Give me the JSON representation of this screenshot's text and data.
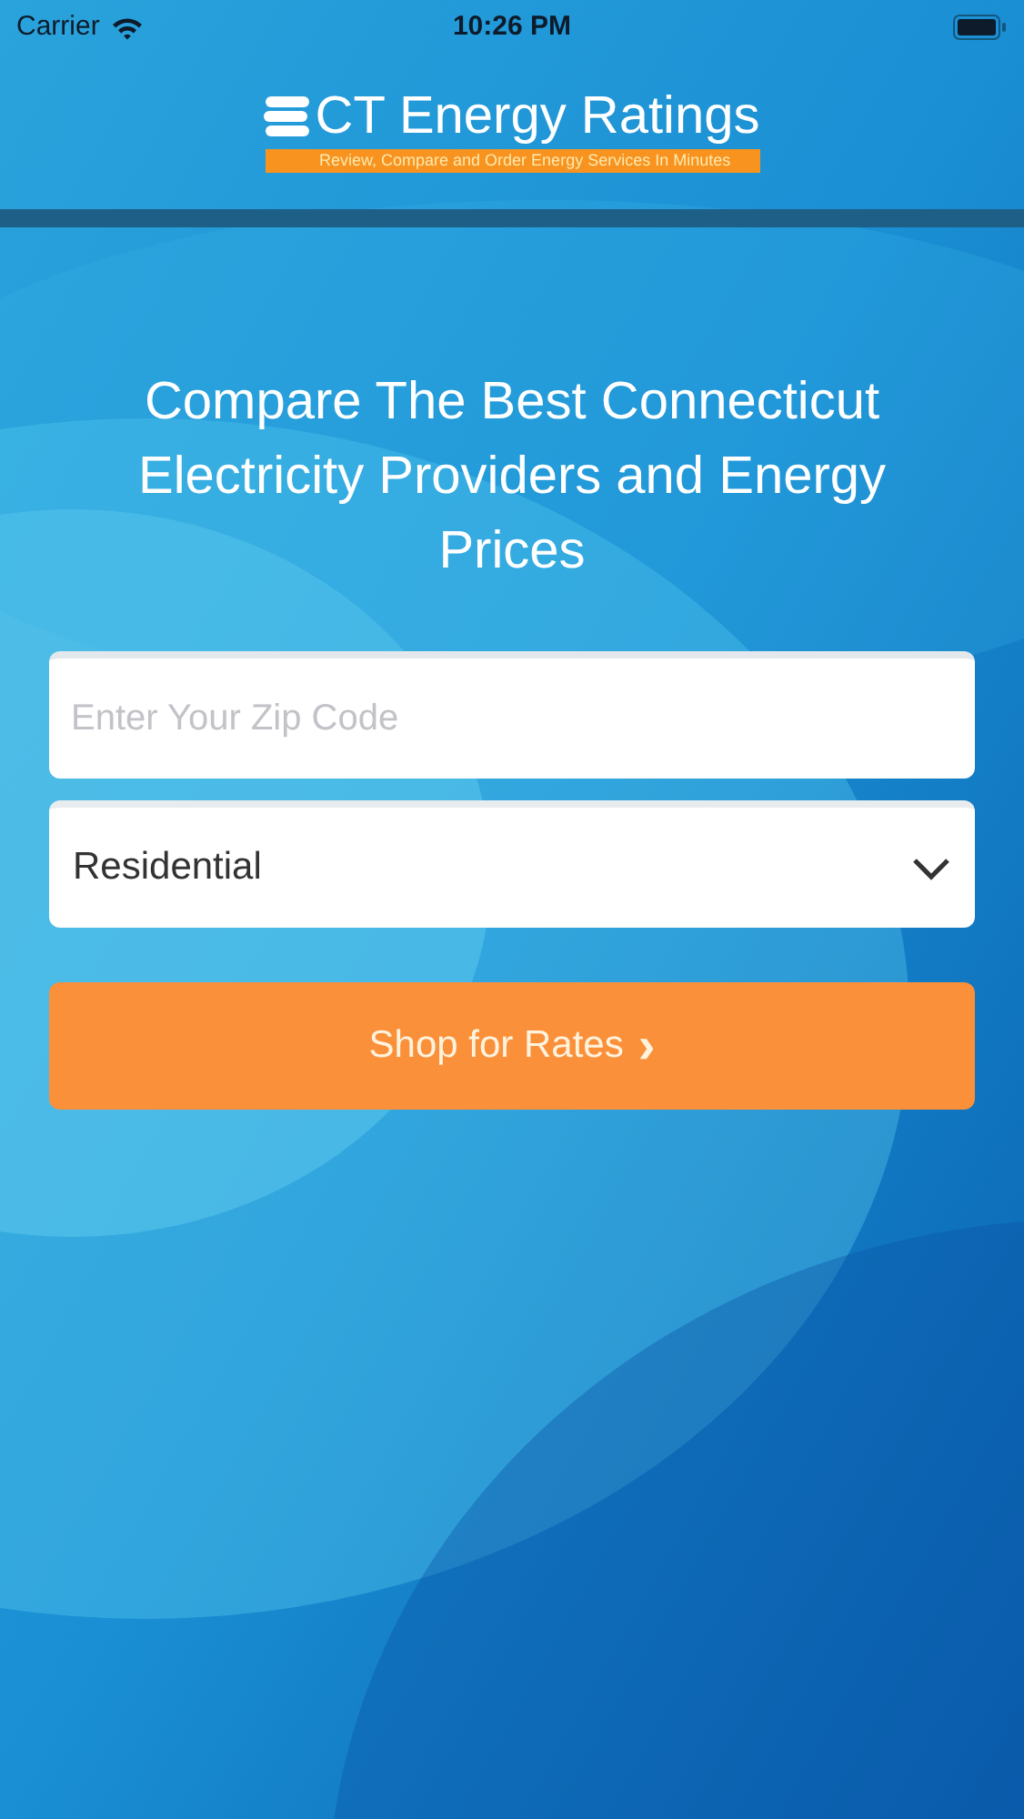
{
  "status_bar": {
    "carrier": "Carrier",
    "time": "10:26 PM"
  },
  "header": {
    "logo_text": "CT Energy Ratings",
    "tagline": "Review, Compare and Order Energy Services In Minutes"
  },
  "heading": "Compare The Best Connecticut Electricity Providers and Energy Prices",
  "zip_field": {
    "placeholder": "Enter Your Zip Code"
  },
  "type_select": {
    "value": "Residential"
  },
  "submit_button": {
    "label": "Shop for Rates",
    "icon": "›"
  }
}
